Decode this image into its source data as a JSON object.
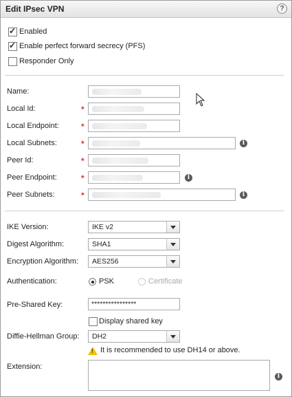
{
  "dialog": {
    "title": "Edit IPsec VPN",
    "help_label": "?"
  },
  "options": {
    "enabled": {
      "label": "Enabled",
      "checked": true
    },
    "pfs": {
      "label": "Enable perfect forward secrecy (PFS)",
      "checked": true
    },
    "responder_only": {
      "label": "Responder Only",
      "checked": false
    }
  },
  "fields": {
    "name": {
      "label": "Name:"
    },
    "local_id": {
      "label": "Local Id:"
    },
    "local_endpoint": {
      "label": "Local Endpoint:"
    },
    "local_subnets": {
      "label": "Local Subnets:"
    },
    "peer_id": {
      "label": "Peer Id:"
    },
    "peer_endpoint": {
      "label": "Peer Endpoint:"
    },
    "peer_subnets": {
      "label": "Peer Subnets:"
    },
    "required_mark": "*"
  },
  "ike": {
    "version_label": "IKE Version:",
    "version_value": "IKE v2",
    "digest_label": "Digest Algorithm:",
    "digest_value": "SHA1",
    "encryption_label": "Encryption Algorithm:",
    "encryption_value": "AES256"
  },
  "auth": {
    "label": "Authentication:",
    "psk_label": "PSK",
    "psk_selected": true,
    "certificate_label": "Certificate",
    "certificate_enabled": false
  },
  "psk": {
    "label": "Pre-Shared Key:",
    "masked_value": "****************",
    "display_label": "Display shared key",
    "display_checked": false
  },
  "dh": {
    "label": "Diffie-Hellman Group:",
    "value": "DH2",
    "warning": "It is recommended to use DH14 or above."
  },
  "extension": {
    "label": "Extension:",
    "value": ""
  },
  "icons": {
    "info": "info-icon",
    "warning": "warning-icon",
    "help": "help-icon"
  }
}
